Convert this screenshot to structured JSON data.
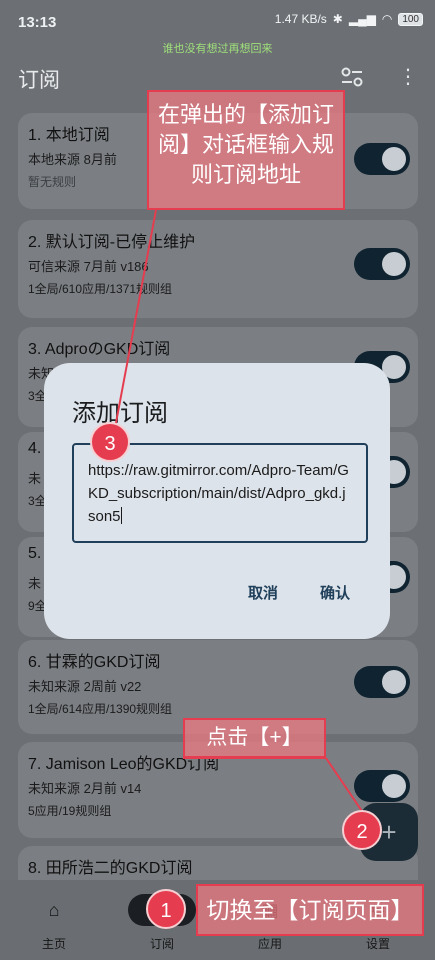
{
  "status_bar": {
    "time": "13:13",
    "banner": "谁也没有想过再想回来",
    "speed": "1.47 KB/s",
    "battery": "100"
  },
  "appbar": {
    "title": "订阅",
    "filter_icon": "filter-icon",
    "more_icon": "more-vertical-icon"
  },
  "subscriptions": [
    {
      "title": "1. 本地订阅",
      "meta": "本地来源   8月前",
      "stats": "暂无规则",
      "enabled": true
    },
    {
      "title": "2. 默认订阅-已停止维护",
      "meta": "可信来源   7月前   v186",
      "stats": "1全局/610应用/1371规则组",
      "enabled": true
    },
    {
      "title": "3. AdproのGKD订阅",
      "meta": "未知",
      "stats": "3全",
      "enabled": true
    },
    {
      "title": "4.",
      "meta": "未",
      "stats": "3全",
      "enabled": true
    },
    {
      "title": "5.",
      "meta": "未",
      "stats": "9全",
      "enabled": true
    },
    {
      "title": "6. 甘霖的GKD订阅",
      "meta": "未知来源   2周前   v22",
      "stats": "1全局/614应用/1390规则组",
      "enabled": true
    },
    {
      "title": "7. Jamison Leo的GKD订阅",
      "meta": "未知来源   2月前   v14",
      "stats": "5应用/19规则组",
      "enabled": true
    },
    {
      "title": "8. 田所浩二的GKD订阅",
      "meta": "",
      "stats": "",
      "enabled": true
    }
  ],
  "dialog": {
    "title": "添加订阅",
    "url_value": "https://raw.gitmirror.com/Adpro-Team/GKD_subscription/main/dist/Adpro_gkd.json5",
    "cancel_label": "取消",
    "confirm_label": "确认"
  },
  "fab": {
    "label": "+"
  },
  "bottom_nav": [
    {
      "label": "主页",
      "icon": "home-icon",
      "glyph": "⌂",
      "active": false
    },
    {
      "label": "订阅",
      "icon": "subscription-icon",
      "glyph": "",
      "active": true
    },
    {
      "label": "应用",
      "icon": "apps-icon",
      "glyph": "▦",
      "active": false
    },
    {
      "label": "设置",
      "icon": "settings-icon",
      "glyph": "⚙",
      "active": false
    }
  ],
  "annotations": {
    "step1": "切换至【订阅页面】",
    "step2": "点击【+】",
    "step3": "在弹出的【添加订阅】对话框输入规则订阅地址",
    "badge1": "1",
    "badge2": "2",
    "badge3": "3"
  },
  "colors": {
    "annotation": "#e53d4f",
    "toggle_on": "#0f2330",
    "dialog_bg": "#dde3ea"
  }
}
